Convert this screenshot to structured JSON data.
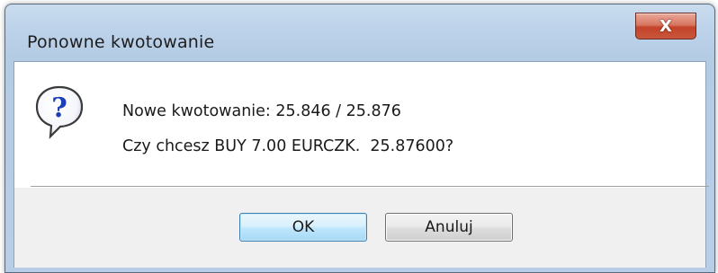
{
  "window": {
    "title": "Ponowne kwotowanie",
    "close_glyph": "X"
  },
  "message": {
    "icon": "question-icon",
    "line1": "Nowe kwotowanie: 25.846 / 25.876",
    "line2": "Czy chcesz BUY 7.00 EURCZK.  25.87600?"
  },
  "buttons": {
    "ok_label": "OK",
    "cancel_label": "Anuluj"
  },
  "colors": {
    "close_button": "#c4432a",
    "default_button_border": "#3c7fb1",
    "question_icon_blue": "#1a3fb8"
  }
}
